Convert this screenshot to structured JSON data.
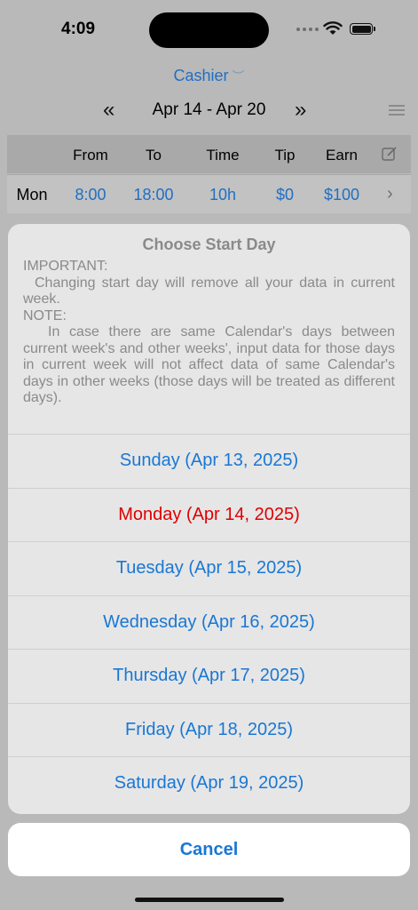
{
  "status": {
    "time": "4:09"
  },
  "header": {
    "job": "Cashier",
    "week_range": "Apr 14 - Apr 20",
    "prev_icon": "double-chevron-left",
    "next_icon": "double-chevron-right"
  },
  "table": {
    "columns": [
      "From",
      "To",
      "Time",
      "Tip",
      "Earn"
    ],
    "rows": [
      {
        "day": "Mon",
        "from": "8:00",
        "to": "18:00",
        "time": "10h",
        "tip": "$0",
        "earn": "$100"
      }
    ]
  },
  "sheet": {
    "title": "Choose Start Day",
    "important_label": "IMPORTANT:",
    "important_text": "Changing start day will remove all your data in current week.",
    "note_label": "NOTE:",
    "note_text": "In case there are same Calendar's days between current week's and other weeks', input data for those days in current week will not affect data of same Calendar's days in other weeks (those days will be treated as different days).",
    "options": [
      {
        "label": "Sunday (Apr 13, 2025)"
      },
      {
        "label": "Monday (Apr 14, 2025)"
      },
      {
        "label": "Tuesday (Apr 15, 2025)"
      },
      {
        "label": "Wednesday (Apr 16, 2025)"
      },
      {
        "label": "Thursday (Apr 17, 2025)"
      },
      {
        "label": "Friday (Apr 18, 2025)"
      },
      {
        "label": "Saturday (Apr 19, 2025)"
      }
    ],
    "selected_index": 1,
    "cancel_label": "Cancel"
  },
  "colors": {
    "accent": "#1977d4",
    "selected": "#e00000"
  }
}
